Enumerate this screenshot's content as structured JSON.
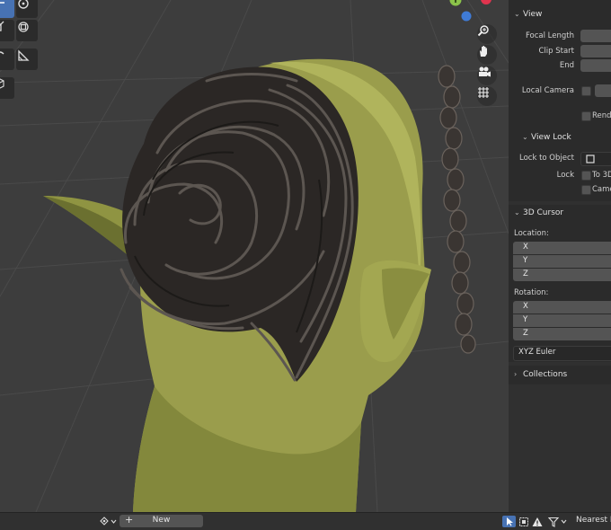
{
  "gizmo": {
    "axis_y_label": "Y",
    "colors": {
      "y_axis": "#8bc34a",
      "x_axis": "#e0344e",
      "z_axis": "#3f7bd6"
    }
  },
  "toolbar_icons": [
    "move-icon",
    "rotate-icon",
    "scale-icon",
    "transform-icon",
    "annotate-icon",
    "measure-icon",
    "add-cube-icon"
  ],
  "nav_buttons": [
    "zoom-icon",
    "hand-pan-icon",
    "camera-icon",
    "grid-view-icon"
  ],
  "sidebar": {
    "view": {
      "title": "View",
      "focal_length_label": "Focal Length",
      "clip_start_label": "Clip Start",
      "end_label": "End",
      "local_camera_label": "Local Camera",
      "render_region_label": "Rende",
      "view_lock": {
        "title": "View Lock",
        "lock_to_object_label": "Lock to Object",
        "lock_label": "Lock",
        "to_3d_label": "To 3D",
        "camera_label": "Came"
      }
    },
    "cursor": {
      "title": "3D Cursor",
      "location_label": "Location:",
      "location": [
        "X",
        "Y",
        "Z"
      ],
      "rotation_label": "Rotation:",
      "rotation": [
        "X",
        "Y",
        "Z"
      ],
      "rotation_mode": "XYZ Euler"
    },
    "collections": {
      "title": "Collections"
    }
  },
  "statusbar": {
    "new_label": "New",
    "plus": "+",
    "interpolation": "Nearest F"
  }
}
